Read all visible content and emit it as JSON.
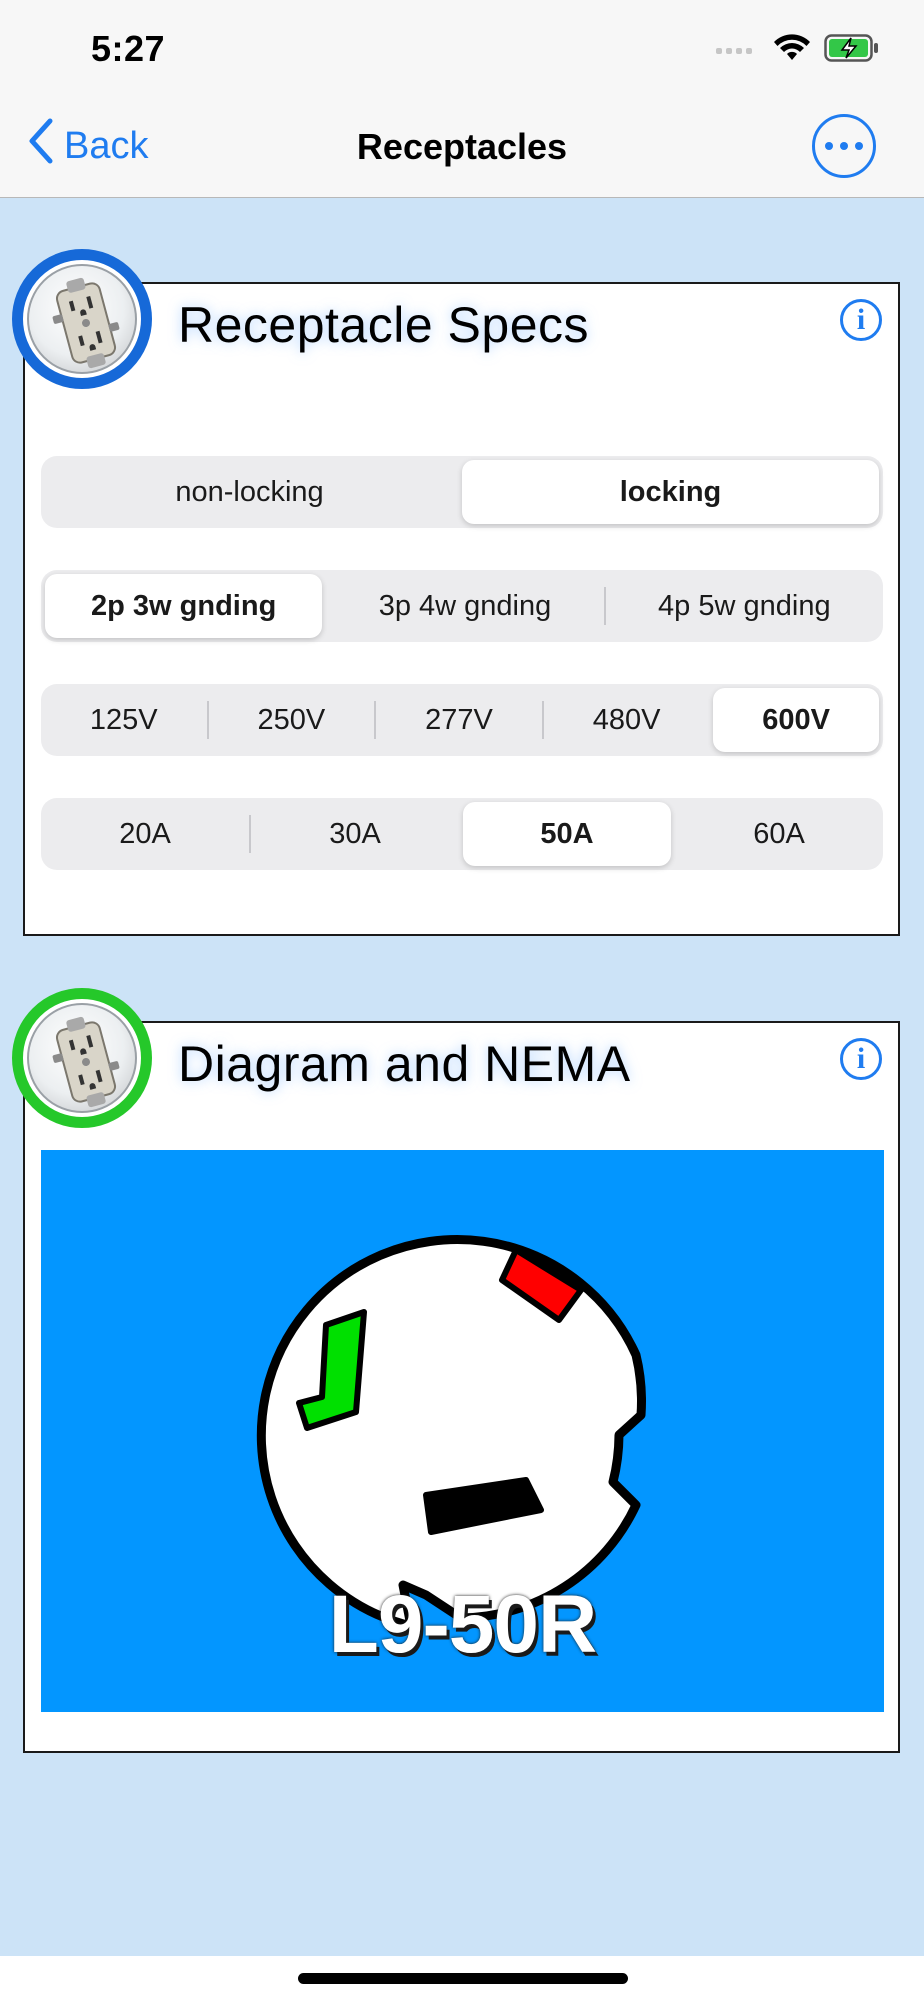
{
  "status_bar": {
    "time": "5:27"
  },
  "nav": {
    "back_label": "Back",
    "title": "Receptacles"
  },
  "cards": {
    "specs": {
      "title": "Receptacle Specs",
      "badge_color": "#1669d8",
      "locking": {
        "options": [
          "non-locking",
          "locking"
        ],
        "selected": "locking"
      },
      "wiring": {
        "options": [
          "2p 3w gnding",
          "3p 4w gnding",
          "4p 5w gnding"
        ],
        "selected": "2p 3w gnding"
      },
      "voltage": {
        "options": [
          "125V",
          "250V",
          "277V",
          "480V",
          "600V"
        ],
        "selected": "600V"
      },
      "amperage": {
        "options": [
          "20A",
          "30A",
          "50A",
          "60A"
        ],
        "selected": "50A"
      }
    },
    "diagram": {
      "title": "Diagram and NEMA",
      "badge_color": "#25c82a",
      "nema_label": "L9-50R",
      "background": "#0396ff",
      "slot_colors": {
        "ground": "#00e000",
        "hot": "#ff0000",
        "neutral": "#000000"
      }
    }
  },
  "icons": {
    "back": "chevron-left-icon",
    "more": "ellipsis-circle-icon",
    "info": "info-circle-icon",
    "signal": "cellular-signal-icon",
    "wifi": "wifi-icon",
    "battery": "battery-charging-icon"
  }
}
